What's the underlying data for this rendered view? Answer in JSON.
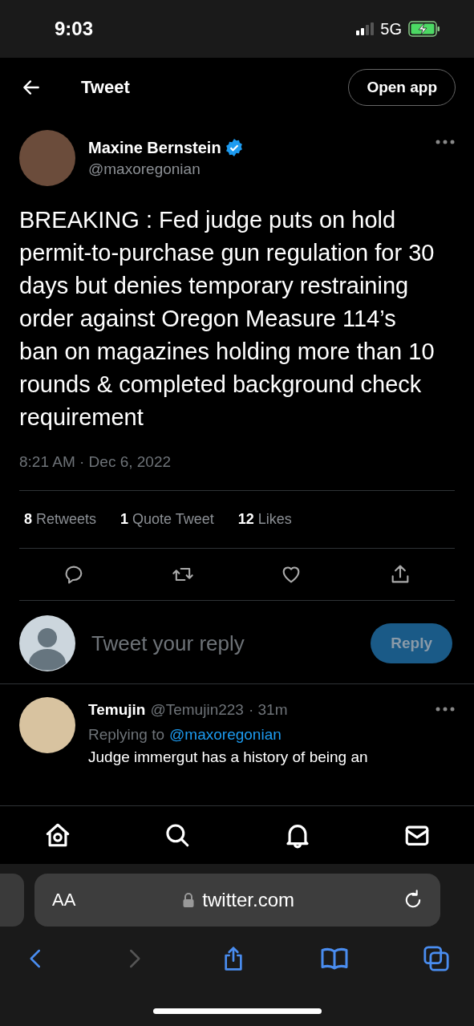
{
  "status_bar": {
    "time": "9:03",
    "network": "5G"
  },
  "header": {
    "title": "Tweet",
    "open_app": "Open app"
  },
  "tweet": {
    "author": "Maxine Bernstein",
    "verified": true,
    "handle": "@maxoregonian",
    "text": "BREAKING : Fed judge puts on hold permit-to-purchase gun regulation for 30 days but denies temporary restraining order against Oregon Measure 114’s ban on magazines holding more than 10 rounds & completed background check requirement",
    "timestamp": "8:21 AM · Dec 6, 2022",
    "stats": [
      {
        "count": "8",
        "label": "Retweets"
      },
      {
        "count": "1",
        "label": "Quote Tweet"
      },
      {
        "count": "12",
        "label": "Likes"
      }
    ]
  },
  "composer": {
    "placeholder": "Tweet your reply",
    "button": "Reply",
    "disabled": true
  },
  "replies": [
    {
      "name": "Temujin",
      "handle": "@Temujin223",
      "time": "· 31m",
      "replying_prefix": "Replying to",
      "replying_to": "@maxoregonian",
      "text": "Judge immergut has a history of being an"
    }
  ],
  "browser": {
    "aa": "AA",
    "url": "twitter.com",
    "back_disabled": false,
    "forward_disabled": true
  }
}
